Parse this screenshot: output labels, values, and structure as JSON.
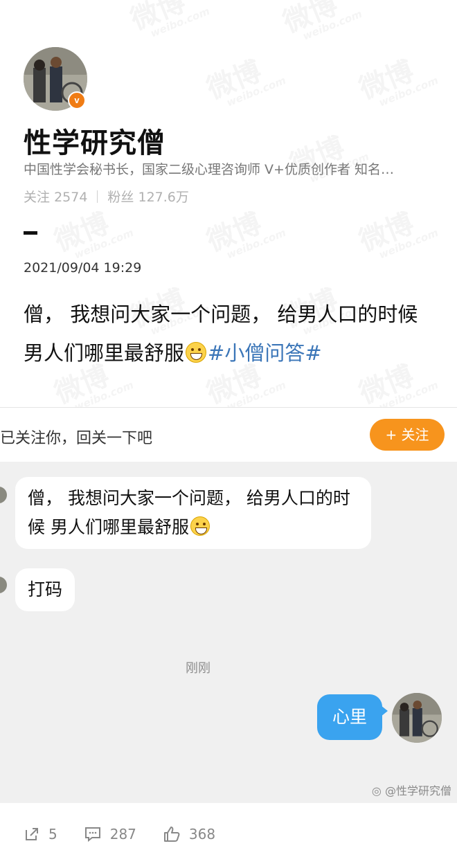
{
  "profile": {
    "name": "性学研究僧",
    "bio": "中国性学会秘书长，国家二级心理咨询师  V+优质创作者 知名…",
    "following_label": "关注",
    "following_count": "2574",
    "followers_label": "粉丝",
    "followers_count": "127.6万",
    "badge": "v"
  },
  "post": {
    "date": "2021/09/04 19:29",
    "text": "僧， 我想问大家一个问题， 给男人口的时候 男人们哪里最舒服",
    "topic": "#小僧问答#"
  },
  "chat": {
    "follow_prompt": "已关注你，回关一下吧",
    "follow_button": "+ 关注",
    "messages": [
      {
        "text": "僧， 我想问大家一个问题， 给男人口的时候 男人们哪里最舒服",
        "emoji": "grinning-face"
      },
      {
        "text": "打码"
      }
    ],
    "time": "刚刚",
    "reply": "心里",
    "credit": "@性学研究僧"
  },
  "actions": {
    "repost": "5",
    "comments": "287",
    "likes": "368"
  },
  "watermark": {
    "text": "微博",
    "sub": "weibo.com"
  },
  "colors": {
    "accent_orange": "#f7941d",
    "topic_blue": "#3b76b8",
    "reply_bubble": "#3aa3ef"
  }
}
